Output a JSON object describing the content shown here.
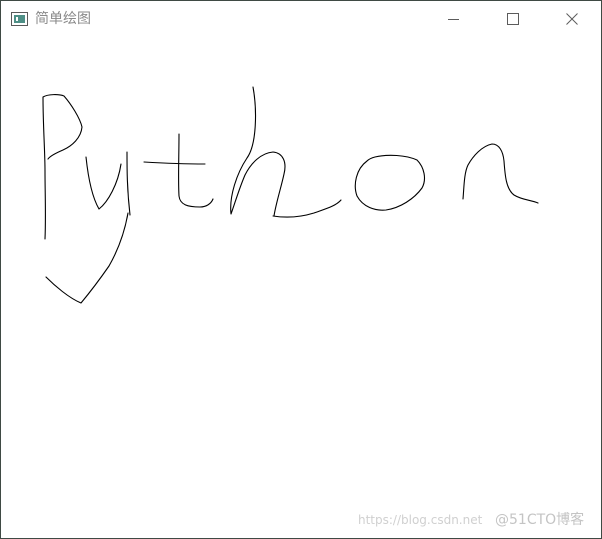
{
  "window": {
    "title": "简单绘图"
  },
  "icons": {
    "app": "window-app-icon",
    "minimize": "minimize-icon",
    "maximize": "maximize-icon",
    "close": "close-icon"
  },
  "colors": {
    "ink": "#000000",
    "title_text": "#8a8a8a",
    "border": "#3f4a44",
    "app_icon_accent": "#4e8f86"
  },
  "watermark": {
    "url": "https://blog.csdn.net",
    "brand": "@51CTO博客"
  }
}
